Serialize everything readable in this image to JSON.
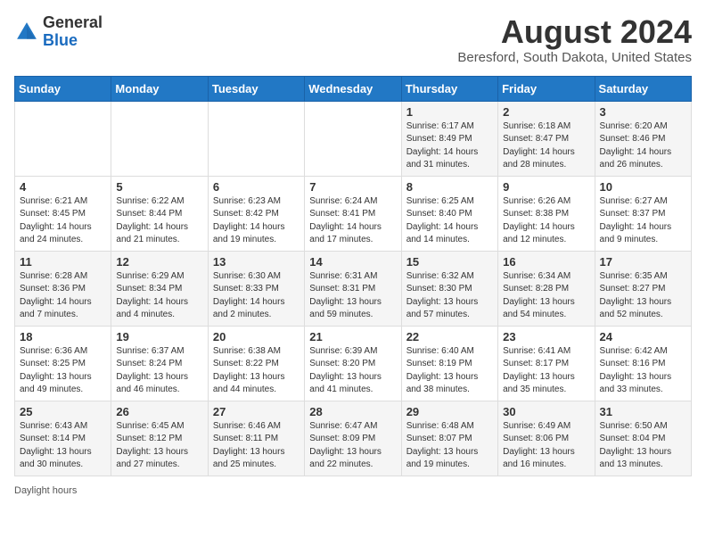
{
  "header": {
    "logo_general": "General",
    "logo_blue": "Blue",
    "month_year": "August 2024",
    "location": "Beresford, South Dakota, United States"
  },
  "days_of_week": [
    "Sunday",
    "Monday",
    "Tuesday",
    "Wednesday",
    "Thursday",
    "Friday",
    "Saturday"
  ],
  "weeks": [
    [
      {
        "day": "",
        "detail": ""
      },
      {
        "day": "",
        "detail": ""
      },
      {
        "day": "",
        "detail": ""
      },
      {
        "day": "",
        "detail": ""
      },
      {
        "day": "1",
        "detail": "Sunrise: 6:17 AM\nSunset: 8:49 PM\nDaylight: 14 hours\nand 31 minutes."
      },
      {
        "day": "2",
        "detail": "Sunrise: 6:18 AM\nSunset: 8:47 PM\nDaylight: 14 hours\nand 28 minutes."
      },
      {
        "day": "3",
        "detail": "Sunrise: 6:20 AM\nSunset: 8:46 PM\nDaylight: 14 hours\nand 26 minutes."
      }
    ],
    [
      {
        "day": "4",
        "detail": "Sunrise: 6:21 AM\nSunset: 8:45 PM\nDaylight: 14 hours\nand 24 minutes."
      },
      {
        "day": "5",
        "detail": "Sunrise: 6:22 AM\nSunset: 8:44 PM\nDaylight: 14 hours\nand 21 minutes."
      },
      {
        "day": "6",
        "detail": "Sunrise: 6:23 AM\nSunset: 8:42 PM\nDaylight: 14 hours\nand 19 minutes."
      },
      {
        "day": "7",
        "detail": "Sunrise: 6:24 AM\nSunset: 8:41 PM\nDaylight: 14 hours\nand 17 minutes."
      },
      {
        "day": "8",
        "detail": "Sunrise: 6:25 AM\nSunset: 8:40 PM\nDaylight: 14 hours\nand 14 minutes."
      },
      {
        "day": "9",
        "detail": "Sunrise: 6:26 AM\nSunset: 8:38 PM\nDaylight: 14 hours\nand 12 minutes."
      },
      {
        "day": "10",
        "detail": "Sunrise: 6:27 AM\nSunset: 8:37 PM\nDaylight: 14 hours\nand 9 minutes."
      }
    ],
    [
      {
        "day": "11",
        "detail": "Sunrise: 6:28 AM\nSunset: 8:36 PM\nDaylight: 14 hours\nand 7 minutes."
      },
      {
        "day": "12",
        "detail": "Sunrise: 6:29 AM\nSunset: 8:34 PM\nDaylight: 14 hours\nand 4 minutes."
      },
      {
        "day": "13",
        "detail": "Sunrise: 6:30 AM\nSunset: 8:33 PM\nDaylight: 14 hours\nand 2 minutes."
      },
      {
        "day": "14",
        "detail": "Sunrise: 6:31 AM\nSunset: 8:31 PM\nDaylight: 13 hours\nand 59 minutes."
      },
      {
        "day": "15",
        "detail": "Sunrise: 6:32 AM\nSunset: 8:30 PM\nDaylight: 13 hours\nand 57 minutes."
      },
      {
        "day": "16",
        "detail": "Sunrise: 6:34 AM\nSunset: 8:28 PM\nDaylight: 13 hours\nand 54 minutes."
      },
      {
        "day": "17",
        "detail": "Sunrise: 6:35 AM\nSunset: 8:27 PM\nDaylight: 13 hours\nand 52 minutes."
      }
    ],
    [
      {
        "day": "18",
        "detail": "Sunrise: 6:36 AM\nSunset: 8:25 PM\nDaylight: 13 hours\nand 49 minutes."
      },
      {
        "day": "19",
        "detail": "Sunrise: 6:37 AM\nSunset: 8:24 PM\nDaylight: 13 hours\nand 46 minutes."
      },
      {
        "day": "20",
        "detail": "Sunrise: 6:38 AM\nSunset: 8:22 PM\nDaylight: 13 hours\nand 44 minutes."
      },
      {
        "day": "21",
        "detail": "Sunrise: 6:39 AM\nSunset: 8:20 PM\nDaylight: 13 hours\nand 41 minutes."
      },
      {
        "day": "22",
        "detail": "Sunrise: 6:40 AM\nSunset: 8:19 PM\nDaylight: 13 hours\nand 38 minutes."
      },
      {
        "day": "23",
        "detail": "Sunrise: 6:41 AM\nSunset: 8:17 PM\nDaylight: 13 hours\nand 35 minutes."
      },
      {
        "day": "24",
        "detail": "Sunrise: 6:42 AM\nSunset: 8:16 PM\nDaylight: 13 hours\nand 33 minutes."
      }
    ],
    [
      {
        "day": "25",
        "detail": "Sunrise: 6:43 AM\nSunset: 8:14 PM\nDaylight: 13 hours\nand 30 minutes."
      },
      {
        "day": "26",
        "detail": "Sunrise: 6:45 AM\nSunset: 8:12 PM\nDaylight: 13 hours\nand 27 minutes."
      },
      {
        "day": "27",
        "detail": "Sunrise: 6:46 AM\nSunset: 8:11 PM\nDaylight: 13 hours\nand 25 minutes."
      },
      {
        "day": "28",
        "detail": "Sunrise: 6:47 AM\nSunset: 8:09 PM\nDaylight: 13 hours\nand 22 minutes."
      },
      {
        "day": "29",
        "detail": "Sunrise: 6:48 AM\nSunset: 8:07 PM\nDaylight: 13 hours\nand 19 minutes."
      },
      {
        "day": "30",
        "detail": "Sunrise: 6:49 AM\nSunset: 8:06 PM\nDaylight: 13 hours\nand 16 minutes."
      },
      {
        "day": "31",
        "detail": "Sunrise: 6:50 AM\nSunset: 8:04 PM\nDaylight: 13 hours\nand 13 minutes."
      }
    ]
  ],
  "footer": {
    "legend": "Daylight hours"
  }
}
